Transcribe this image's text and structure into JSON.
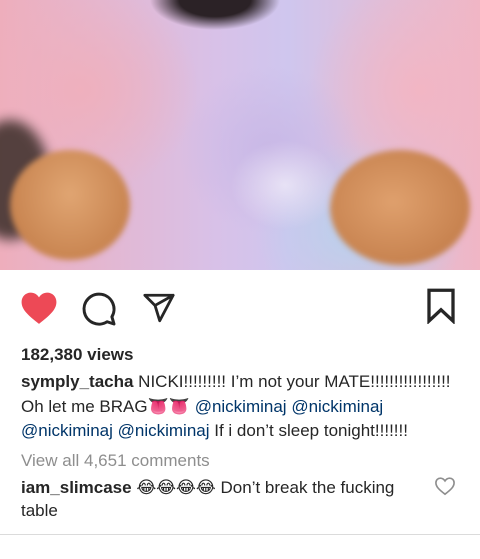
{
  "post": {
    "views": "182,380 views",
    "caption": {
      "username": "symply_tacha",
      "line1_text": " NICKI!!!!!!!!! I’m not your MATE!!!!!!!!!!!!!!!!!",
      "line2_text": " Oh let me BRAG",
      "line2_emoji": "👅👅",
      "mention1": "@nickiminaj",
      "mention2": "@nickiminaj",
      "mention3": "@nickiminaj",
      "mention4": "@nickiminaj",
      "tail": " If i don’t sleep tonight!!!!!!!"
    },
    "view_all_comments": "View all 4,651 comments",
    "comments": [
      {
        "username": "iam_slimcase",
        "emoji": " 😂😂😂😂",
        "text_line1": " Don’t break the fucking",
        "text_line2": "table"
      }
    ]
  },
  "icons": {
    "like": "heart-filled-icon",
    "comment": "comment-bubble-icon",
    "share": "paper-plane-icon",
    "save": "bookmark-icon",
    "comment_like": "heart-outline-icon"
  },
  "colors": {
    "like_red": "#ed4956",
    "mention_blue": "#003569",
    "muted_gray": "#8e8e8e"
  }
}
